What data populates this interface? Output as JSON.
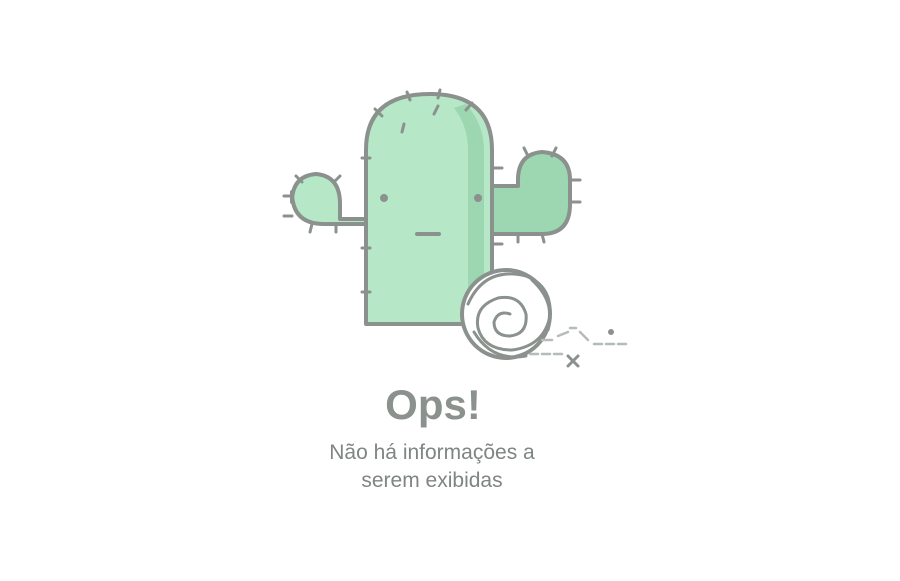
{
  "empty_state": {
    "title": "Ops!",
    "message": "Não há informações a serem exibidas",
    "illustration_icon": "cactus-with-tumbleweed-icon"
  },
  "colors": {
    "cactus_fill": "#b6e8c8",
    "cactus_shade": "#9dd7b1",
    "outline": "#8b918d",
    "title_text": "#8b918d",
    "message_text": "#7f8582",
    "background": "#ffffff"
  }
}
